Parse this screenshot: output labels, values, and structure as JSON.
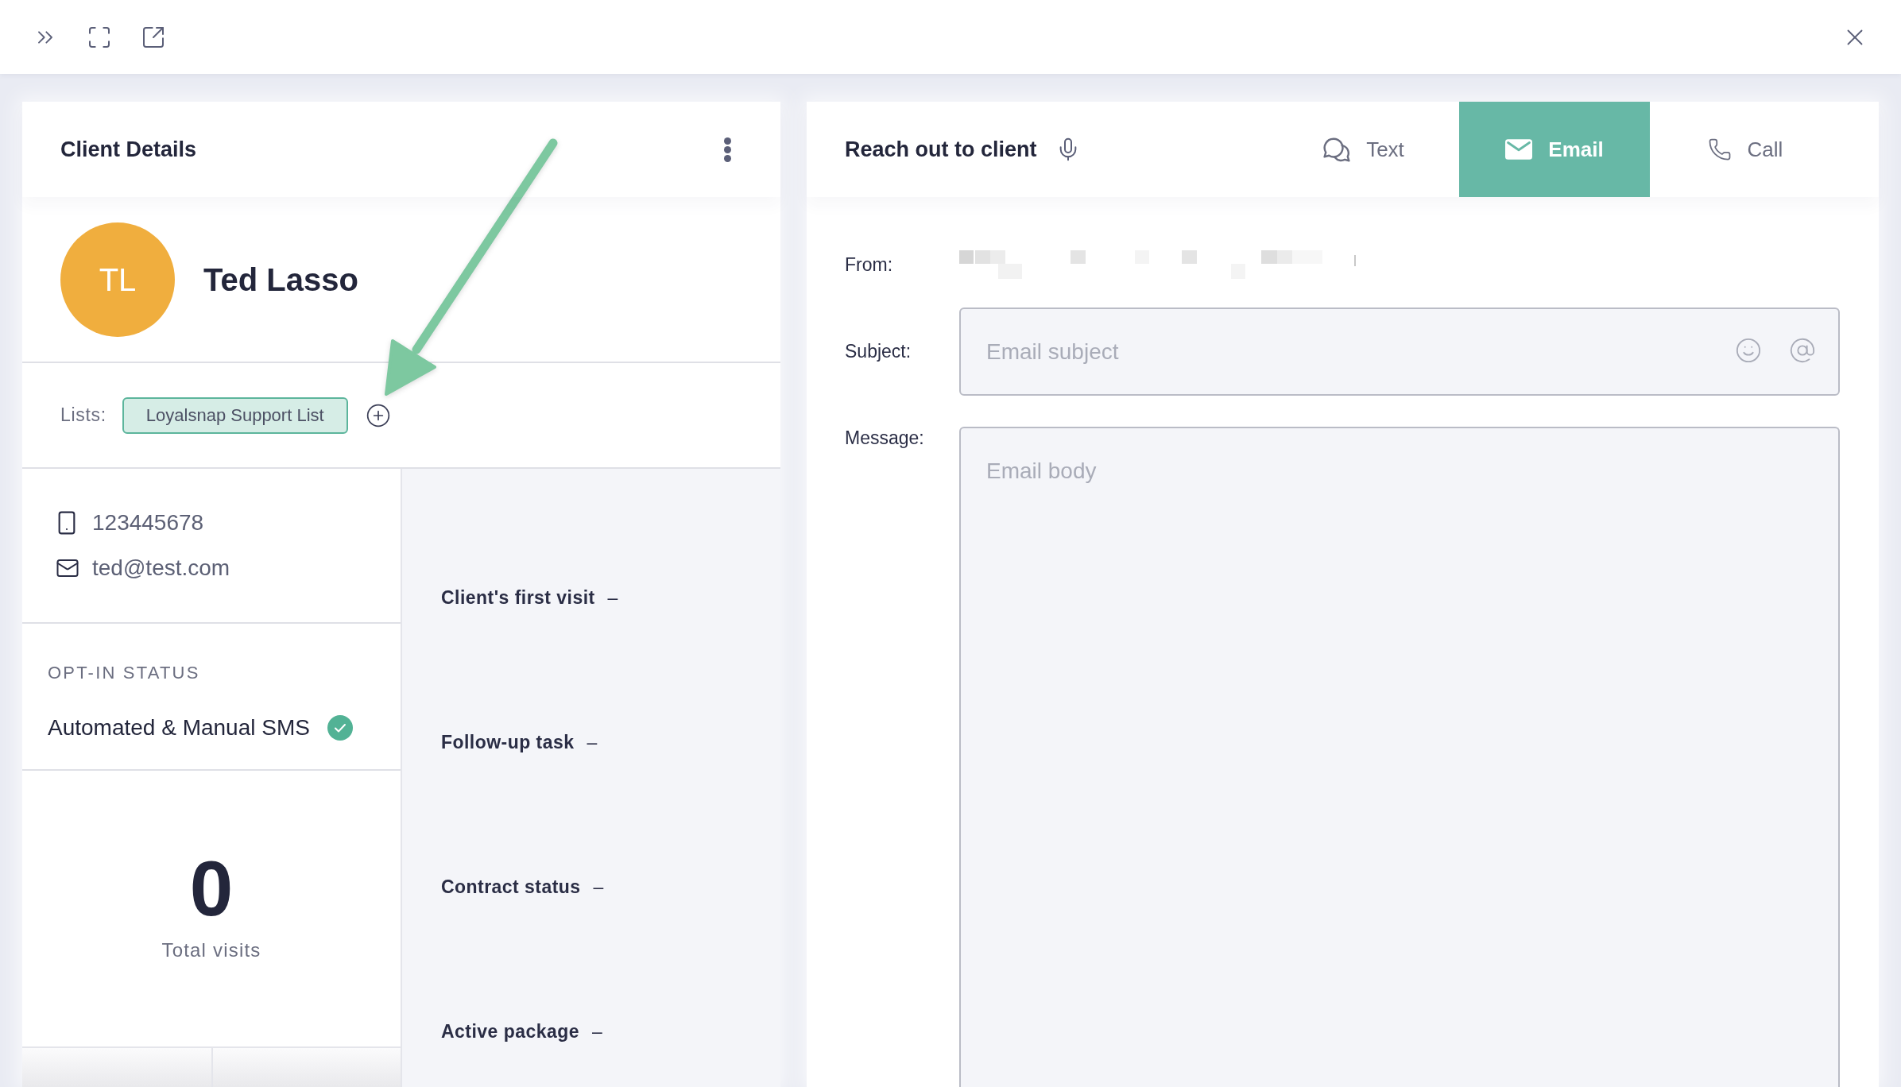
{
  "client_panel": {
    "title": "Client Details",
    "client": {
      "initials": "TL",
      "name": "Ted Lasso"
    },
    "lists": {
      "label": "Lists:",
      "items": [
        "Loyalsnap Support List"
      ]
    },
    "contacts": [
      {
        "kind": "phone",
        "value": "123445678"
      },
      {
        "kind": "email",
        "value": "ted@test.com"
      }
    ],
    "opt_in": {
      "heading": "OPT-IN STATUS",
      "status": "Automated & Manual SMS",
      "confirmed": true
    },
    "total_visits": {
      "count": "0",
      "label": "Total visits"
    },
    "details": [
      {
        "label": "Client's first visit",
        "value": "–"
      },
      {
        "label": "Follow-up task",
        "value": "–"
      },
      {
        "label": "Contract status",
        "value": "–"
      },
      {
        "label": "Active package",
        "value": "–"
      }
    ]
  },
  "reach_out_panel": {
    "title": "Reach out to client",
    "tabs": [
      {
        "kind": "text",
        "label": "Text",
        "selected": false
      },
      {
        "kind": "email",
        "label": "Email",
        "selected": true
      },
      {
        "kind": "call",
        "label": "Call",
        "selected": false
      }
    ],
    "form": {
      "from": {
        "label": "From:",
        "redacted": true
      },
      "subject": {
        "label": "Subject:",
        "placeholder": "Email subject"
      },
      "message": {
        "label": "Message:",
        "placeholder": "Email body"
      }
    }
  }
}
